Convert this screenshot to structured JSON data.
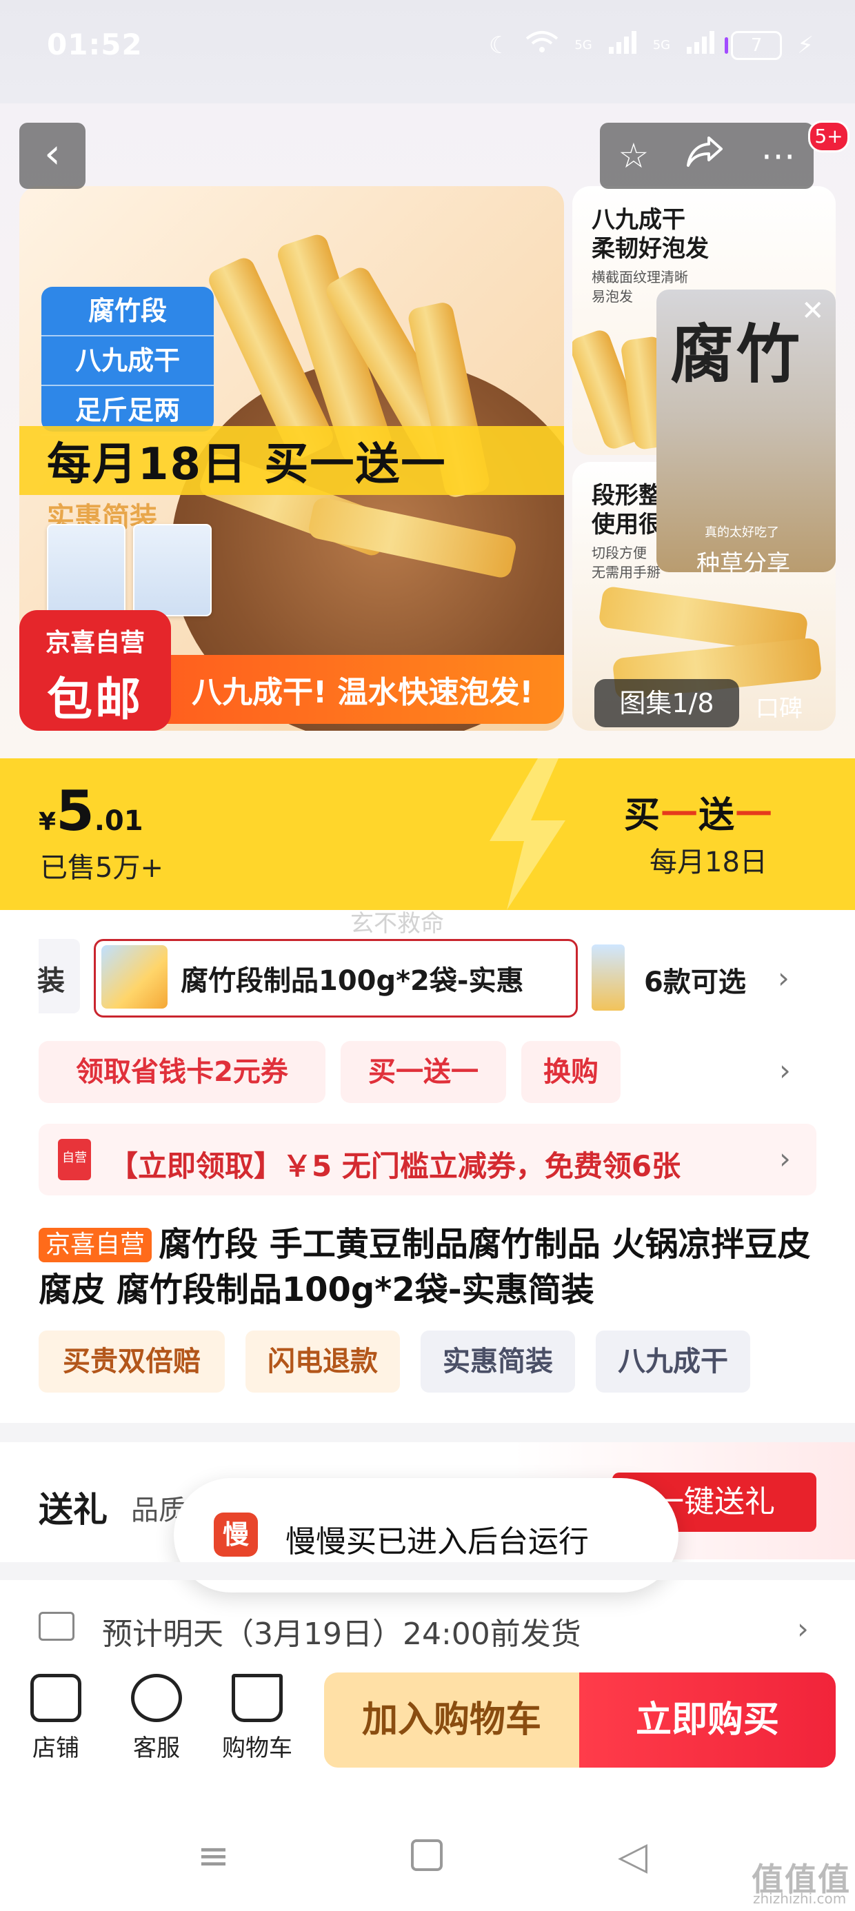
{
  "status_bar": {
    "time": "01:52",
    "network_1": "5G",
    "network_2": "5G",
    "battery": "7"
  },
  "gallery": {
    "badge_count": "5+",
    "main_image": {
      "tag_lines": [
        "腐竹段",
        "八九成干",
        "足斤足两",
        "实惠简装"
      ],
      "promo": "每月18日 买一送一",
      "shop_badge_line1": "京喜自营",
      "shop_badge_line2": "包邮",
      "bottom_text": "八九成干! 温水快速泡发!"
    },
    "thumb1": {
      "title": "八九成干\n柔韧好泡发",
      "sub": "横截面纹理清晰\n易泡发"
    },
    "thumb2": {
      "title": "段形整\n使用很",
      "sub": "切段方便\n无需用手掰"
    },
    "video_card": {
      "big_text": "腐竹",
      "caption": "真的太好吃了",
      "label": "种草分享"
    },
    "pager": "图集1/8",
    "pager_secondary": "口碑"
  },
  "price_bar": {
    "currency": "¥",
    "price_int": "5",
    "price_dec": ".01",
    "sold": "已售5万+",
    "promo_parts": [
      "买",
      "一",
      "送",
      "一"
    ],
    "promo_date": "每月18日",
    "watermark": "玄不救命"
  },
  "variants": {
    "prev_fragment": "装",
    "selected": "腐竹段制品100g*2袋-实惠",
    "count": "6款可选"
  },
  "chips": [
    "领取省钱卡2元券",
    "买一送一",
    "换购"
  ],
  "coupon": {
    "icon_label": "自营",
    "text": "【立即领取】￥5 无门槛立减券，免费领6张"
  },
  "title": {
    "tag": "京喜自营",
    "text": "腐竹段 手工黄豆制品腐竹制品 火锅凉拌豆皮腐皮 腐竹段制品100g*2袋-实惠简装"
  },
  "services": [
    "买贵双倍赔",
    "闪电退款",
    "实惠简装",
    "八九成干"
  ],
  "gift": {
    "label": "送礼",
    "sub": "品质",
    "button": "一键送礼"
  },
  "toast": {
    "icon": "慢",
    "text": "慢慢买已进入后台运行"
  },
  "delivery": "预计明天（3月19日）24:00前发货",
  "bottom_bar": {
    "shop": "店铺",
    "service": "客服",
    "cart": "购物车",
    "add_to_cart": "加入购物车",
    "buy_now": "立即购买"
  },
  "corner_watermark": {
    "mark": "值值值",
    "url": "zhizhizhi.com"
  },
  "colors": {
    "accent_red": "#e8222b",
    "price_yellow": "#ffd62b",
    "cart_orange": "#ffe0a6"
  }
}
